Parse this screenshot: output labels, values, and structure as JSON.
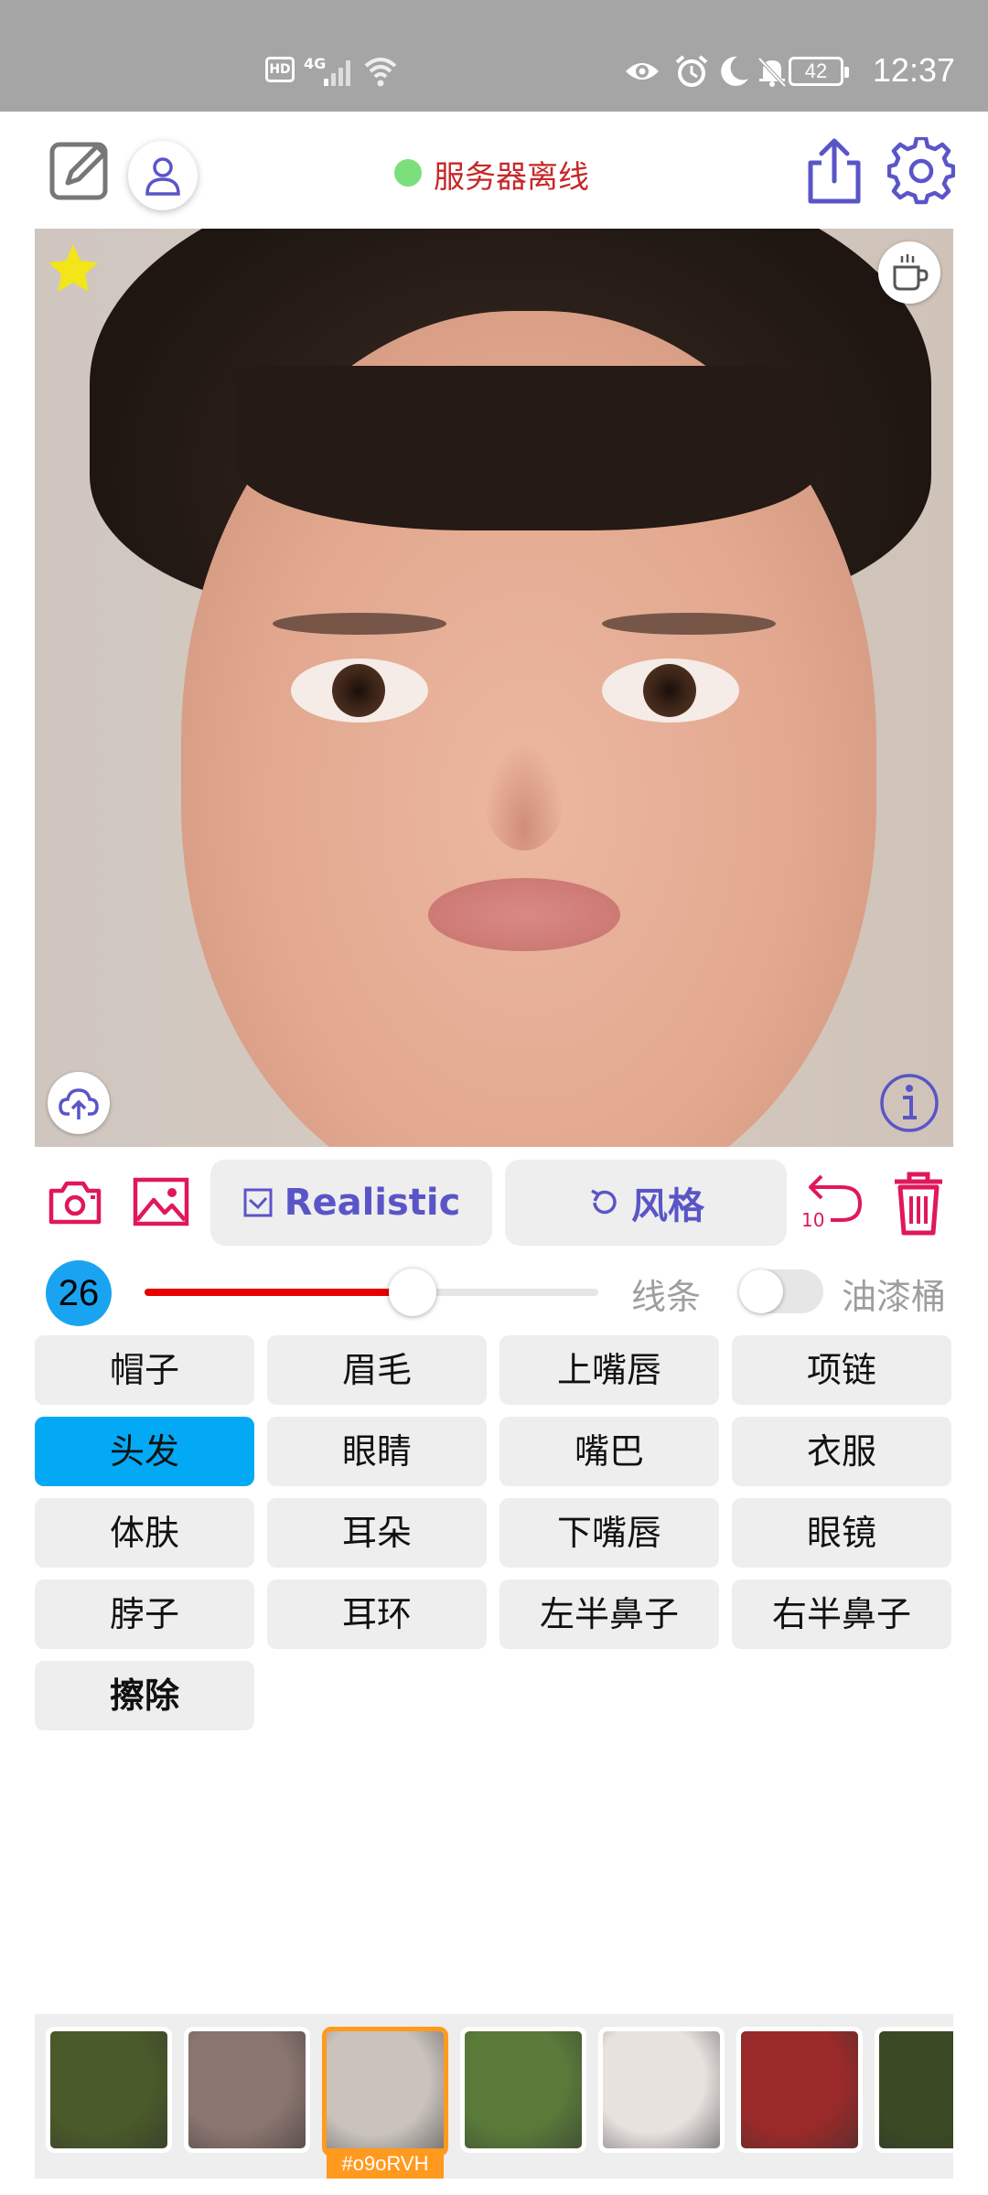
{
  "status_bar": {
    "time": "12:37",
    "battery": "42",
    "network": "4G",
    "hd": "HD",
    "icons": [
      "eye-icon",
      "alarm-icon",
      "moon-icon",
      "bell-off-icon",
      "battery-icon",
      "wifi-icon",
      "signal-icon"
    ]
  },
  "top_bar": {
    "server_status": "服务器离线",
    "status_color": "#7be07b",
    "icons": [
      "edit-icon",
      "user-icon",
      "share-icon",
      "settings-icon"
    ]
  },
  "image_overlay": {
    "icons": [
      "star-icon",
      "coffee-icon",
      "upload-icon",
      "info-icon"
    ],
    "star_color": "#f2e51a"
  },
  "toolbar": {
    "model_label": "Realistic",
    "style_label": "风格",
    "undo_count": "10",
    "accent": "#e0185a",
    "primary": "#5a55c7"
  },
  "slider_row": {
    "brush_size": "26",
    "slider_fraction": 0.59,
    "line_label": "线条",
    "bucket_label": "油漆桶",
    "bucket_enabled": false
  },
  "labels": {
    "items": [
      "帽子",
      "眉毛",
      "上嘴唇",
      "项链",
      "头发",
      "眼睛",
      "嘴巴",
      "衣服",
      "体肤",
      "耳朵",
      "下嘴唇",
      "眼镜",
      "脖子",
      "耳环",
      "左半鼻子",
      "右半鼻子",
      "擦除"
    ],
    "selected": "头发"
  },
  "palette": {
    "selected_tag": "#o9oRVH",
    "swatch_colors": [
      "#4a5a2a",
      "#8a7570",
      "#cac3bd",
      "#5a7a3a",
      "#e8e2df",
      "#9a2a2a",
      "#3a4a25"
    ]
  }
}
